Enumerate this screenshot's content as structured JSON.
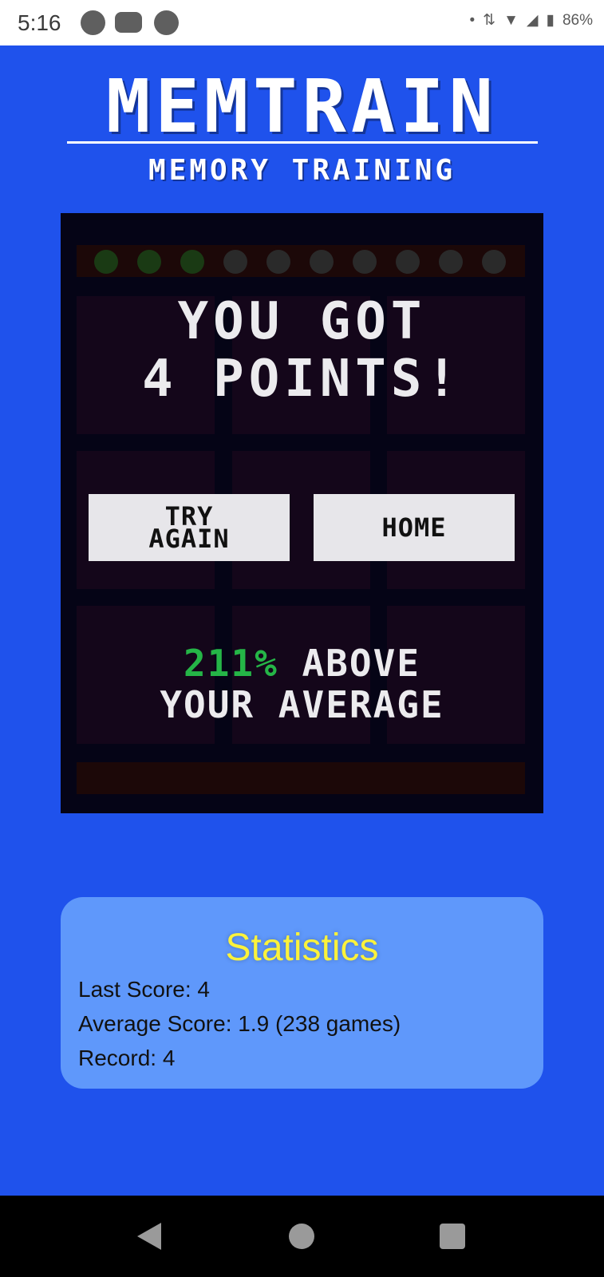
{
  "status_bar": {
    "time": "5:16",
    "battery": "86%",
    "notification_icons": [
      "spotify-icon",
      "youtube-icon",
      "app-icon"
    ]
  },
  "header": {
    "title": "MEMTRAIN",
    "subtitle": "MEMORY TRAINING"
  },
  "game": {
    "result_line1": "YOU GOT",
    "result_line2": "4 POINTS!",
    "try_again_line1": "TRY",
    "try_again_line2": "AGAIN",
    "home_label": "HOME",
    "percent": "211%",
    "above_text": " ABOVE",
    "average_text": "YOUR AVERAGE",
    "lights_lit": 3,
    "lights_total": 10,
    "colors": {
      "light_on": "#1a3a14",
      "light_off": "#2a2a2a",
      "percent": "#25b547"
    }
  },
  "statistics": {
    "title": "Statistics",
    "last_score": "Last Score: 4",
    "average_score": "Average Score: 1.9 (238 games)",
    "record": "Record: 4"
  }
}
